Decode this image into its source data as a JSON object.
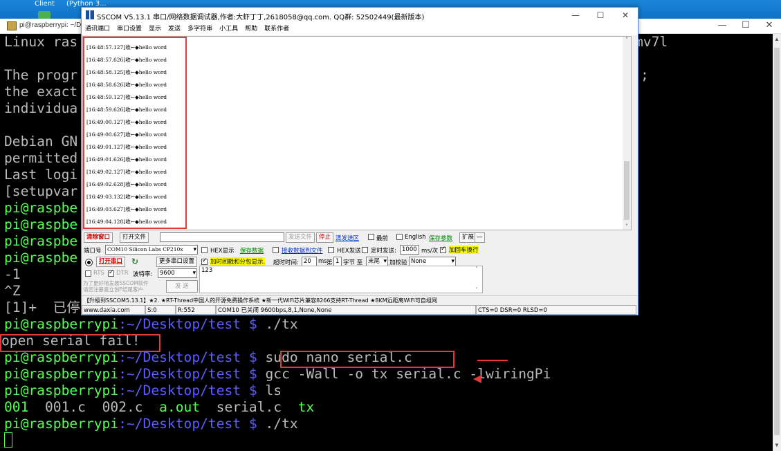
{
  "desktop": {
    "labels": [
      "Client",
      "(Python 3..."
    ]
  },
  "putty": {
    "title": "pi@raspberrypi: ~/D",
    "window_buttons": [
      "—",
      "☐",
      "✕"
    ],
    "terminal": {
      "lines": [
        {
          "text": "Linux ras",
          "tail": "mv7l"
        },
        {
          "text": "The progr",
          "tail": ";"
        },
        {
          "text": "the exact"
        },
        {
          "text": "individua"
        },
        {
          "text": "Debian GN"
        },
        {
          "text": "permitted"
        },
        {
          "text": "Last logi"
        },
        {
          "text": "[setupvar"
        },
        {
          "text": "pi@raspbe"
        },
        {
          "text": "pi@raspbe"
        },
        {
          "text": "pi@raspbe"
        },
        {
          "text": "pi@raspbe"
        },
        {
          "text": "-1"
        },
        {
          "text": "^Z"
        },
        {
          "text": "[1]+  已停"
        }
      ],
      "prompt_user": "pi@raspberrypi",
      "prompt_path": ":~/Desktop/test $",
      "cmd_run": " ./tx",
      "error": "open serial fail!",
      "cmd_nano": " sudo nano serial.c",
      "cmd_gcc": " gcc -Wall -o tx serial.c -lwiringPi",
      "cmd_ls": " ls",
      "ls_output": [
        "001",
        "001.c",
        "002.c",
        "a.out",
        "serial.c",
        "tx"
      ],
      "cmd_run2": " ./tx"
    }
  },
  "sscom": {
    "title": "SSCOM V5.13.1 串口/网络数据调试器,作者:大虾丁丁,2618058@qq.com. QQ群: 52502449(最新版本)",
    "window_buttons": [
      "—",
      "☐",
      "✕"
    ],
    "menu": [
      "通讯端口",
      "串口设置",
      "显示",
      "发送",
      "多字符串",
      "小工具",
      "帮助",
      "联系作者"
    ],
    "receive_lines": [
      "[16:48:57.127]收←◆hello word",
      "[16:48:57.626]收←◆hello word",
      "[16:48:58.125]收←◆hello word",
      "[16:48:58.626]收←◆hello word",
      "[16:48:59.127]收←◆hello word",
      "[16:48:59.626]收←◆hello word",
      "[16:49:00.127]收←◆hello word",
      "[16:49:00.627]收←◆hello word",
      "[16:49:01.127]收←◆hello word",
      "[16:49:01.626]收←◆hello word",
      "[16:49:02.127]收←◆hello word",
      "[16:49:02.628]收←◆hello word",
      "[16:49:03.132]收←◆hello word",
      "[16:49:03.627]收←◆hello word",
      "[16:49:04.128]收←◆hello word"
    ],
    "toolbar1": {
      "clear_window": "清除窗口",
      "open_file": "打开文件",
      "send_file": "发送文件",
      "stop": "停止",
      "clear_send": "清发送区",
      "topmost": "最前",
      "english": "English",
      "save_params": "保存参数",
      "expand": "扩展",
      "collapse": "—"
    },
    "toolbar2": {
      "port_label": "端口号",
      "port_value": "COM10 Silicon Labs CP210x",
      "hex_display": "HEX显示",
      "save_data": "保存数据",
      "recv_to_file": "接收数据到文件",
      "hex_send": "HEX发送",
      "timed_send": "定时发送:",
      "interval": "1000",
      "interval_unit": "ms/次",
      "add_crlf": "加回车换行"
    },
    "toolbar3": {
      "open_port": "打开串口",
      "more_settings": "更多串口设置",
      "timestamp": "加时间戳和分包显示.",
      "timeout_label": "超时时间:",
      "timeout": "20",
      "timeout_unit": "ms",
      "byte_label": "第",
      "byte_from": "1",
      "byte_mid": "字节 至",
      "byte_to": "末尾",
      "checksum_label": "加校验",
      "checksum": "None"
    },
    "toolbar4": {
      "rts": "RTS",
      "dtr": "DTR",
      "baud_label": "波特率:",
      "baud": "9600",
      "send_text": "123",
      "send_button": "发 送",
      "promo1": "为了更好地发展SSCOM软件",
      "promo2": "请您注册嘉立创F结尾客户"
    },
    "ticker": "【升级到SSCOM5.13.1】★2. ★RT-Thread中国人的开源免费操作系统 ★新一代WiFi芯片兼容8266支持RT-Thread ★8KM远距离WiFi可自组网",
    "status": {
      "website": "www.daxia.com",
      "sent": "S:0",
      "received": "R:552",
      "port_state": "COM10 已关闭  9600bps,8,1,None,None",
      "lines": "CTS=0 DSR=0 RLSD=0"
    }
  }
}
